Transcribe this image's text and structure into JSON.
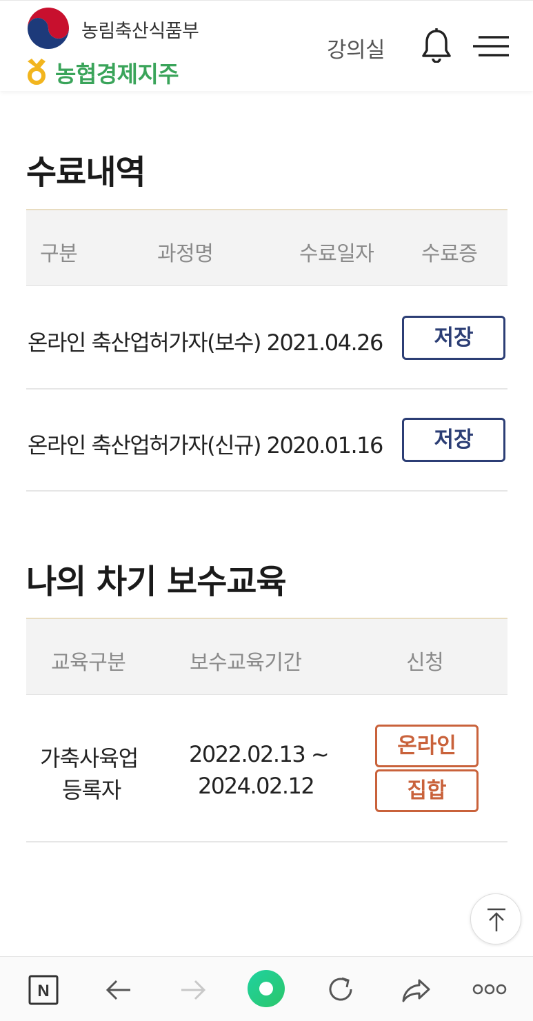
{
  "header": {
    "gov_name": "농림축산식품부",
    "org_name": "농협경제지주",
    "lecture_room": "강의실"
  },
  "completion": {
    "title": "수료내역",
    "columns": [
      "구분",
      "과정명",
      "수료일자",
      "수료증"
    ],
    "rows": [
      {
        "course": "온라인 축산업허가자(보수) 2021.04.26",
        "button": "저장"
      },
      {
        "course": "온라인 축산업허가자(신규) 2020.01.16",
        "button": "저장"
      }
    ]
  },
  "refresher": {
    "title": "나의 차기 보수교육",
    "columns": [
      "교육구분",
      "보수교육기간",
      "신청"
    ],
    "rows": [
      {
        "type_line1": "가축사육업",
        "type_line2": "등록자",
        "period_line1": "2022.02.13 ~",
        "period_line2": "2024.02.12",
        "online_button": "온라인",
        "group_button": "집합"
      }
    ]
  },
  "colors": {
    "navy_button": "#2c3e75",
    "orange_button": "#c9623b",
    "nh_green": "#3aa45a",
    "header_border": "#e8dcc0"
  },
  "icons": [
    "gov-emblem-icon",
    "nh-logo-icon",
    "bell-icon",
    "hamburger-menu-icon",
    "scroll-top-icon",
    "naver-n-icon",
    "back-arrow-icon",
    "forward-arrow-icon",
    "green-dot-icon",
    "refresh-icon",
    "share-icon",
    "more-icon"
  ]
}
